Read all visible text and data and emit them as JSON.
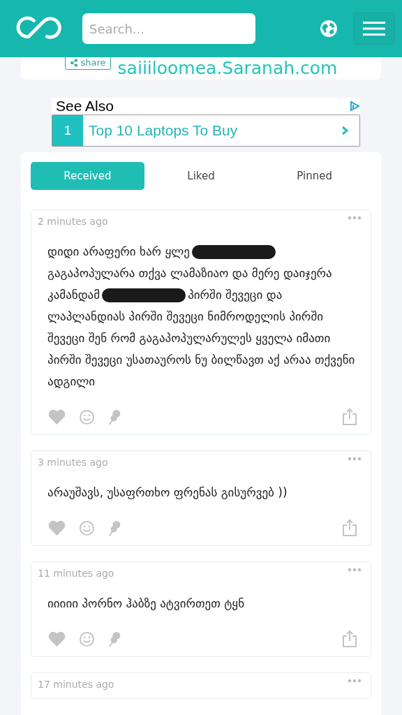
{
  "header": {
    "search": {
      "placeholder": "Search..."
    }
  },
  "profile_card": {
    "share_label": "share",
    "link": "saiiiloomea.Saranah.com"
  },
  "ad": {
    "title": "See Also",
    "items": [
      {
        "number": "1",
        "text": "Top 10 Laptops To Buy"
      }
    ]
  },
  "tabs": [
    {
      "label": "Received",
      "selected": true
    },
    {
      "label": "Liked",
      "selected": false
    },
    {
      "label": "Pinned",
      "selected": false
    }
  ],
  "messages": [
    {
      "time": "2 minutes ago",
      "segments": [
        {
          "kind": "text",
          "text": "დიდი არაფერი ხარ ყლე"
        },
        {
          "kind": "redacted"
        },
        {
          "kind": "text",
          "text": " გაგაპოპულარა თქვა ლამაზიაო და მერე დაიჯერა კამანდამ"
        },
        {
          "kind": "redacted"
        },
        {
          "kind": "text",
          "text": "პირში შევეცი და ლაპლანდიას პირში შევეცი ნიმროდელის პირში შევეცი შენ რომ გაგაპოპულარულეს ყველა იმათი პირში შევეცი უსათაუროს ნუ ბილწავთ აქ არაა თქვენი ადგილი"
        }
      ],
      "actions": true
    },
    {
      "time": "3 minutes ago",
      "segments": [
        {
          "kind": "text",
          "text": "არაუშავს, უსაფრთხო ფრენას გისურვებ ))"
        }
      ],
      "actions": true
    },
    {
      "time": "11 minutes ago",
      "segments": [
        {
          "kind": "text",
          "text": "იიიიი პორნო ჰაბზე ატვირთეთ ტყნ"
        }
      ],
      "actions": true
    },
    {
      "time": "17 minutes ago",
      "actions": false
    }
  ]
}
